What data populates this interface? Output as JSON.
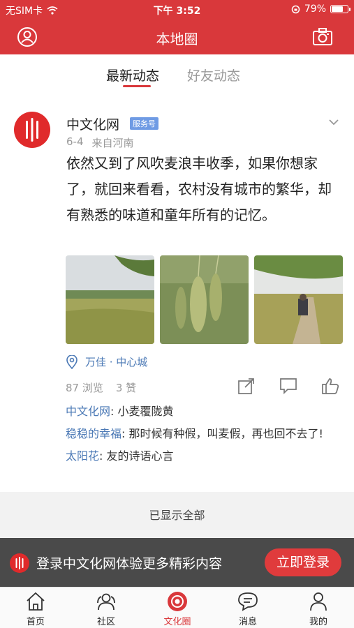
{
  "status_bar": {
    "carrier": "无SIM卡",
    "time": "下午 3:52",
    "battery": "79%",
    "battery_level": 0.79
  },
  "nav": {
    "title": "本地圈",
    "left_icon": "profile-icon",
    "right_icon": "camera-icon"
  },
  "tabs": [
    {
      "label": "最新动态",
      "active": true
    },
    {
      "label": "好友动态",
      "active": false
    }
  ],
  "post": {
    "author": "中文化网",
    "badge": "服务号",
    "date": "6-4",
    "source": "来自河南",
    "text": "依然又到了风吹麦浪丰收季，如果你想家了，就回来看看，农村没有城市的繁华，却有熟悉的味道和童年所有的记忆。",
    "location": "万佳 · 中心城",
    "views": "87 浏览",
    "likes": "3 赞",
    "actions": [
      "share-icon",
      "comment-icon",
      "like-icon"
    ]
  },
  "comments": [
    {
      "user": "中文化网",
      "text": ": 小麦覆陇黄"
    },
    {
      "user": "稳稳的幸福",
      "text": ": 那时候有种假，叫麦假，再也回不去了!"
    },
    {
      "user": "太阳花",
      "text": ": 友的诗语心言"
    }
  ],
  "show_all": "已显示全部",
  "login_bar": {
    "text": "登录中文化网体验更多精彩内容",
    "button": "立即登录"
  },
  "bottom_tabs": [
    {
      "label": "首页",
      "icon": "home-icon",
      "active": false
    },
    {
      "label": "社区",
      "icon": "community-icon",
      "active": false
    },
    {
      "label": "文化圈",
      "icon": "culture-circle-icon",
      "active": true
    },
    {
      "label": "消息",
      "icon": "message-icon",
      "active": false
    },
    {
      "label": "我的",
      "icon": "user-icon",
      "active": false
    }
  ],
  "colors": {
    "brand_red": "#d9383b",
    "link_blue": "#4a78b5",
    "badge_blue": "#6f9be4"
  }
}
